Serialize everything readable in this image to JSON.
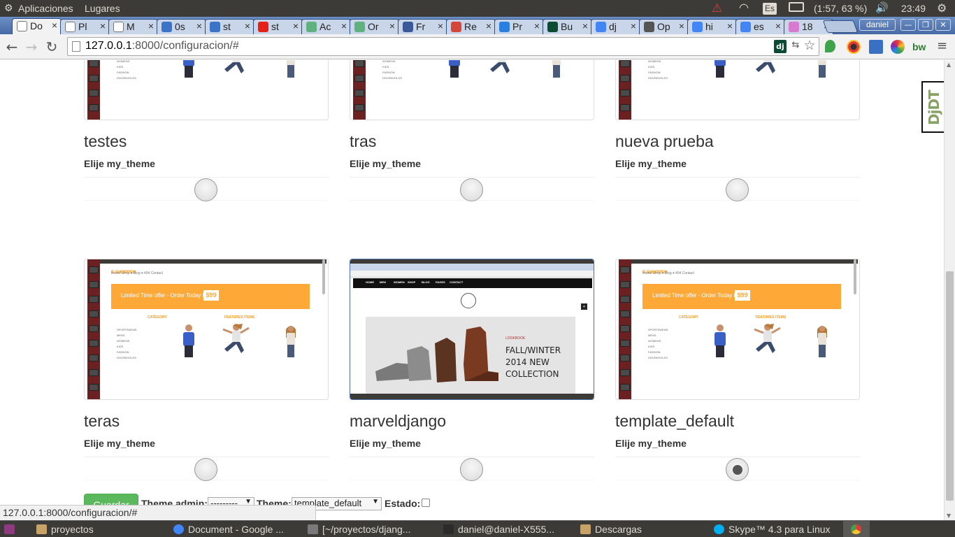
{
  "topbar": {
    "apps_label": "Aplicaciones",
    "places_label": "Lugares",
    "keyboard_lang": "Es",
    "battery_text": "(1:57, 63 %)",
    "clock": "23:49"
  },
  "tabs": [
    {
      "label": "Do",
      "icon": "page-icon",
      "color": "#ffffff",
      "active": true
    },
    {
      "label": "Pl",
      "icon": "page-icon",
      "color": "#ffffff"
    },
    {
      "label": "M",
      "icon": "page-icon",
      "color": "#ffffff"
    },
    {
      "label": "0s",
      "icon": "shield-icon",
      "color": "#3b73c7"
    },
    {
      "label": "st",
      "icon": "shield-icon",
      "color": "#3b73c7"
    },
    {
      "label": "st",
      "icon": "youtube-icon",
      "color": "#e62117"
    },
    {
      "label": "Ac",
      "icon": "circle-icon",
      "color": "#5fb27f"
    },
    {
      "label": "Or",
      "icon": "circle-icon",
      "color": "#5fb27f"
    },
    {
      "label": "Fr",
      "icon": "facebook-icon",
      "color": "#3b5998"
    },
    {
      "label": "Re",
      "icon": "gmail-icon",
      "color": "#d44638"
    },
    {
      "label": "Pr",
      "icon": "dropbox-icon",
      "color": "#2a7fe0"
    },
    {
      "label": "Bu",
      "icon": "django-icon",
      "color": "#0c4b33"
    },
    {
      "label": "dj",
      "icon": "google-icon",
      "color": "#4285f4"
    },
    {
      "label": "Op",
      "icon": "openid-icon",
      "color": "#555555"
    },
    {
      "label": "hi",
      "icon": "google-icon",
      "color": "#4285f4"
    },
    {
      "label": "es",
      "icon": "google-icon",
      "color": "#4285f4"
    },
    {
      "label": "18",
      "icon": "butterfly-icon",
      "color": "#d77ad0"
    }
  ],
  "window_user": "daniel",
  "address": {
    "host": "127.0.0.1",
    "rest": ":8000/configuracion/#"
  },
  "themes": [
    {
      "name": "testes",
      "choose_label": "Elije my_theme",
      "selected": false,
      "thumb": "shopper"
    },
    {
      "name": "tras",
      "choose_label": "Elije my_theme",
      "selected": false,
      "thumb": "shopper"
    },
    {
      "name": "nueva prueba",
      "choose_label": "Elije my_theme",
      "selected": false,
      "thumb": "shopper"
    },
    {
      "name": "teras",
      "choose_label": "Elije my_theme",
      "selected": false,
      "thumb": "shopper"
    },
    {
      "name": "marveldjango",
      "choose_label": "Elije my_theme",
      "selected": false,
      "thumb": "marvel"
    },
    {
      "name": "template_default",
      "choose_label": "Elije my_theme",
      "selected": true,
      "thumb": "shopper"
    }
  ],
  "shopper_thumb": {
    "logo": "E-SHOPPER",
    "menu": "Home   Shop ▾   Blog ▾   404   Contact",
    "banner_text": "Limited Time offer - Order Today For",
    "banner_price": "$99",
    "category_heading": "CATEGORY",
    "features_heading": "FEATURES ITEMS",
    "categories": [
      "SPORTSWEAR",
      "MENS",
      "WOMENS",
      "KIDS",
      "FASHION",
      "HOUSEHOLDS"
    ]
  },
  "marvel_thumb": {
    "nav": [
      "HOME",
      "MEN",
      "WOMEN",
      "SHOP",
      "BLOG",
      "PAGES",
      "CONTACT"
    ],
    "lookbook": "LOOKBOOK",
    "headline_1": "FALL/WINTER",
    "headline_2": "2014 NEW",
    "headline_3": "COLLECTION"
  },
  "form": {
    "save_label": "Guardar",
    "theme_admin_label": "Theme admin:",
    "theme_admin_value": "---------",
    "theme_label": "Theme:",
    "theme_value": "template_default",
    "status_label": "Estado:"
  },
  "status_bubble": "127.0.0.1:8000/configuracion/#",
  "djdt_label": "DjDT",
  "taskbar": [
    {
      "label": "proyectos",
      "icon": "folder-icon",
      "color": "#c7a36a"
    },
    {
      "label": "Document - Google ...",
      "icon": "chrome-icon",
      "color": "#4285f4"
    },
    {
      "label": "[~/proyectos/djang...",
      "icon": "editor-icon",
      "color": "#7a7a7a"
    },
    {
      "label": "daniel@daniel-X555...",
      "icon": "terminal-icon",
      "color": "#2b2b2b"
    },
    {
      "label": "Descargas",
      "icon": "folder-icon",
      "color": "#c7a36a"
    },
    {
      "label": "Skype™ 4.3 para Linux",
      "icon": "skype-icon",
      "color": "#00aff0"
    }
  ]
}
